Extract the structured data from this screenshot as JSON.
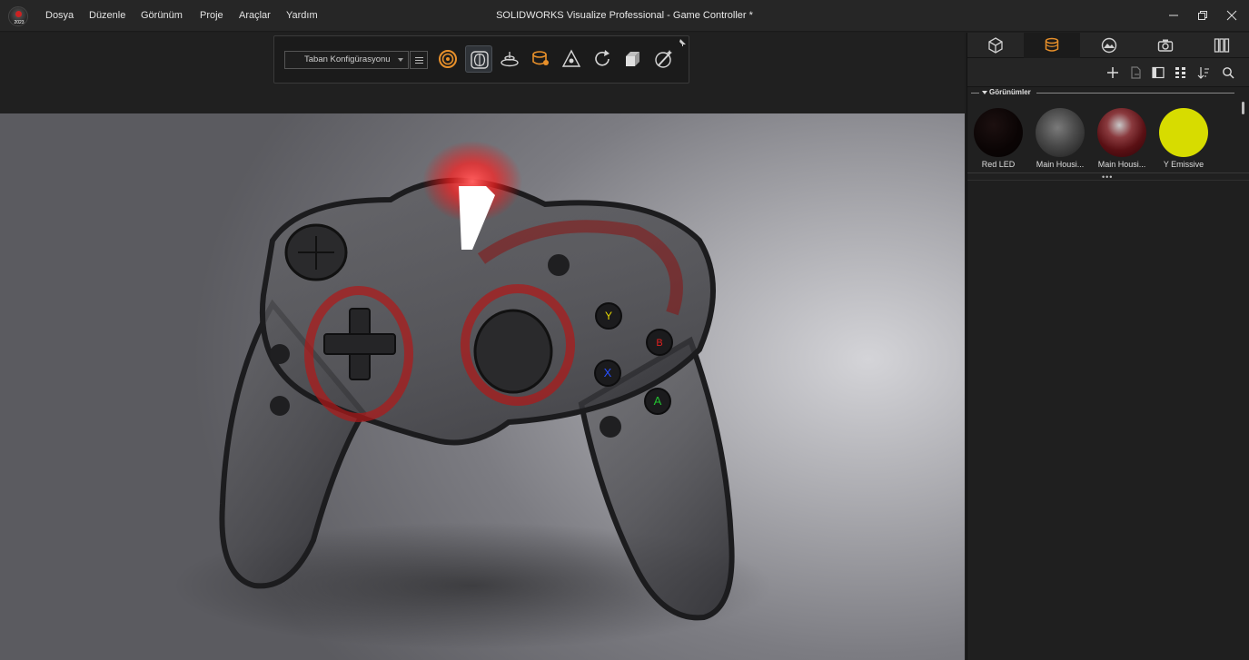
{
  "app": {
    "logo_year": "2023",
    "logo_icon": "solidworks-visualize-logo",
    "window_title": "SOLIDWORKS Visualize Professional - Game Controller *"
  },
  "menu": {
    "items": [
      {
        "label": "Dosya"
      },
      {
        "label": "Düzenle"
      },
      {
        "label": "Görünüm"
      },
      {
        "label": "Proje"
      },
      {
        "label": "Araçlar"
      },
      {
        "label": "Yardım"
      }
    ]
  },
  "window_controls": {
    "minimize": "minimize-icon",
    "restore": "restore-icon",
    "close": "close-icon"
  },
  "toolbar": {
    "configuration": {
      "selected": "Taban Konfigürasyonu"
    },
    "tools": [
      {
        "icon": "target-rings-icon",
        "active": false
      },
      {
        "icon": "part-select-icon",
        "active": true
      },
      {
        "icon": "floor-plane-icon",
        "active": false
      },
      {
        "icon": "appearance-drop-icon",
        "active": false
      },
      {
        "icon": "transform-gizmo-icon",
        "active": false
      },
      {
        "icon": "refresh-icon",
        "active": false
      },
      {
        "icon": "box-cube-icon",
        "active": false
      },
      {
        "icon": "magic-wand-icon",
        "active": false
      }
    ],
    "pin_icon": "pin-icon"
  },
  "panel": {
    "tabs": [
      {
        "icon": "models-cube-icon",
        "active": false
      },
      {
        "icon": "appearances-icon",
        "active": true
      },
      {
        "icon": "scenes-icon",
        "active": false
      },
      {
        "icon": "cameras-icon",
        "active": false
      },
      {
        "icon": "libraries-icon",
        "active": false
      }
    ],
    "actions": [
      "add-icon",
      "export-icon",
      "panel-layout-icon",
      "grid-view-icon",
      "sort-icon",
      "search-icon"
    ],
    "section_title": "Görünümler",
    "appearances": [
      {
        "label": "Red LED",
        "color": "#0b0505"
      },
      {
        "label": "Main Housi...",
        "color": "#3a3a3a"
      },
      {
        "label": "Main Housi...",
        "color": "#5a1014"
      },
      {
        "label": "Y Emissive",
        "color": "#d7dc00"
      }
    ]
  },
  "colors": {
    "accent": "#e8902a",
    "led_red": "#ff2a2a",
    "btn_y": "#e6d800",
    "btn_b": "#e02020",
    "btn_x": "#2850ff",
    "btn_a": "#22c030"
  },
  "controller": {
    "face_buttons": [
      "Y",
      "B",
      "X",
      "A"
    ]
  }
}
